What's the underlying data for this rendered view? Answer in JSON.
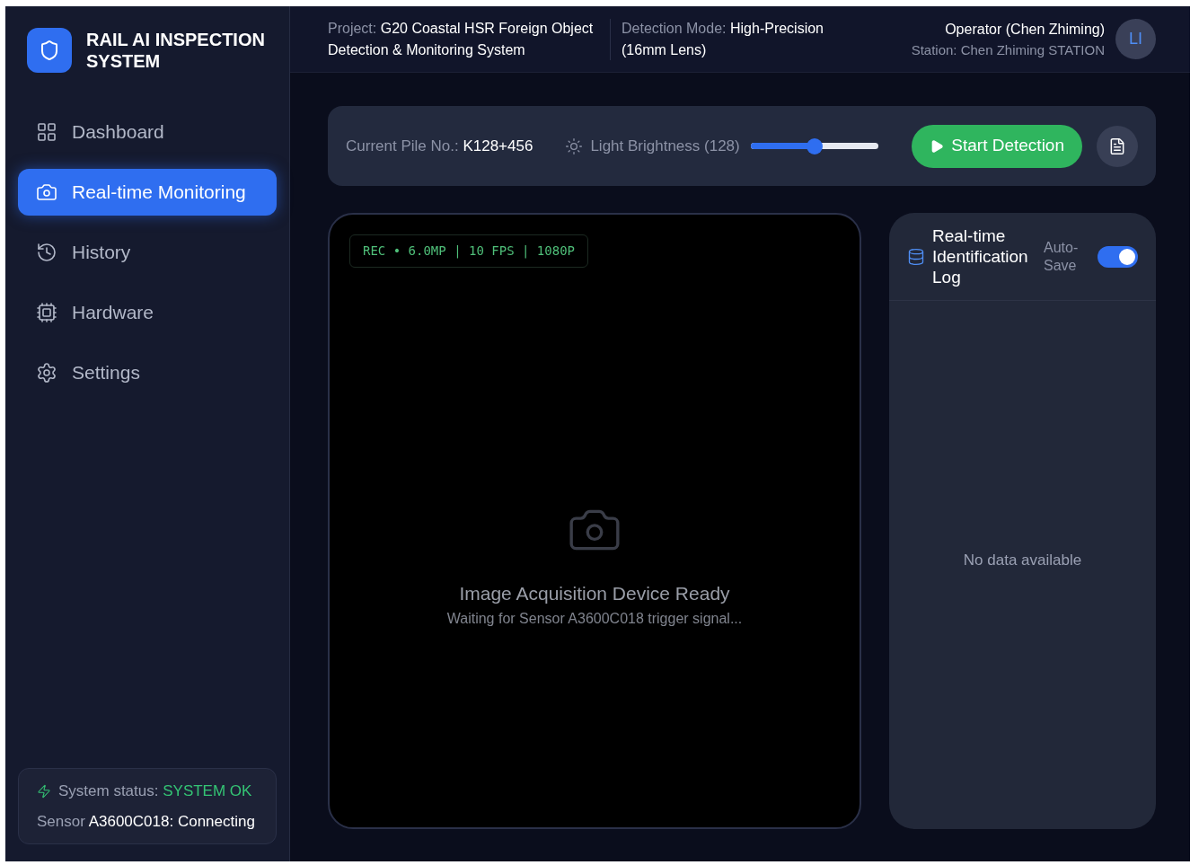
{
  "brand": {
    "title": "RAIL AI INSPECTION SYSTEM"
  },
  "nav": [
    {
      "label": "Dashboard",
      "selected": false
    },
    {
      "label": "Real-time Monitoring",
      "selected": true
    },
    {
      "label": "History",
      "selected": false
    },
    {
      "label": "Hardware",
      "selected": false
    },
    {
      "label": "Settings",
      "selected": false
    }
  ],
  "status": {
    "label": "System status:",
    "value": "SYSTEM OK",
    "sensor_label": "Sensor",
    "sensor_value": "A3600C018: Connecting"
  },
  "header": {
    "project_label": "Project:",
    "project": "G20 Coastal HSR Foreign Object Detection & Monitoring System",
    "mode_label": "Detection Mode:",
    "mode": "High-Precision (16mm Lens)",
    "operator": "Operator (Chen Zhiming)",
    "station": "Station: Chen Zhiming STATION",
    "avatar": "LI"
  },
  "toolbar": {
    "pile_label": "Current Pile No.:",
    "pile": "K128+456",
    "brightness_label": "Light Brightness (128)",
    "brightness": {
      "level": 0.5
    },
    "start_button": "Start Detection"
  },
  "camera": {
    "overlay": "REC • 6.0MP | 10 FPS | 1080P",
    "title": "Image Acquisition Device Ready",
    "subtitle": "Waiting for Sensor A3600C018 trigger signal..."
  },
  "log": {
    "title": "Real-time Identification Log",
    "auto_save_label": "Auto-Save",
    "auto_save": true,
    "empty": "No data available"
  }
}
